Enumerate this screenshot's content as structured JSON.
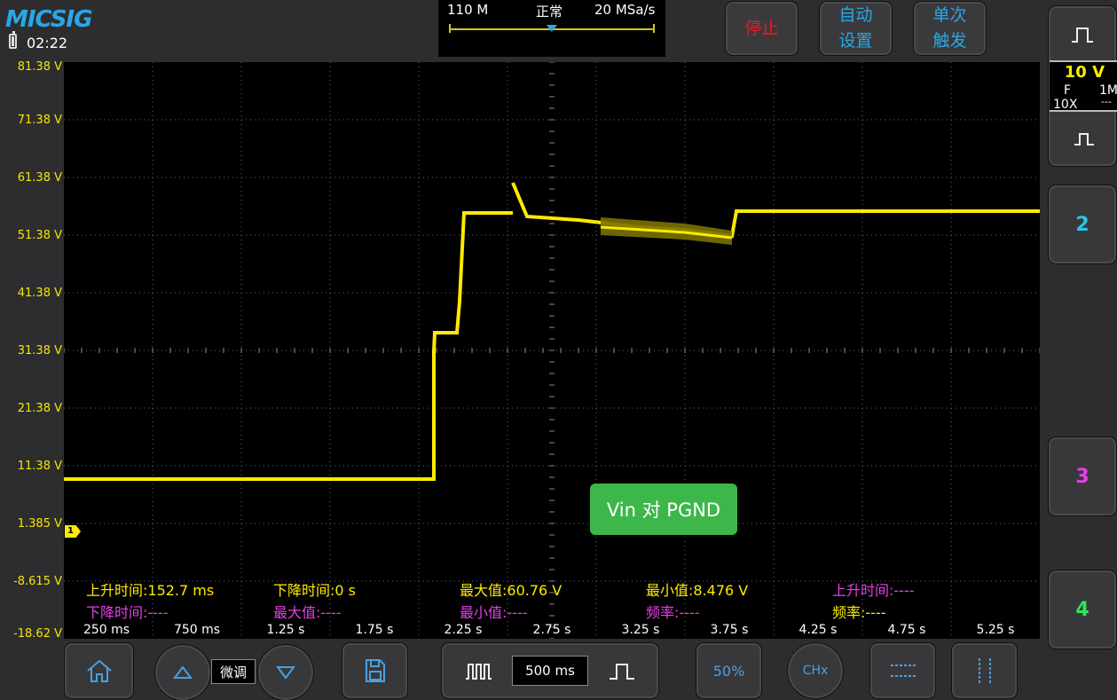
{
  "logo": "MICSIG",
  "status": {
    "time": "02:22"
  },
  "timebase": {
    "memory": "110 M",
    "mode": "正常",
    "sample_rate": "20 MSa/s"
  },
  "top_buttons": {
    "stop": {
      "label": "停止",
      "color": "#e02020"
    },
    "auto_setup": {
      "label_line1": "自动",
      "label_line2": "设置",
      "color": "#2aa7e6"
    },
    "single_trigger": {
      "label_line1": "单次",
      "label_line2": "触发",
      "color": "#2aa7e6"
    }
  },
  "channel1": {
    "scale": "10 V",
    "coupling": "F",
    "probe": "10X",
    "impedance": "1M",
    "impedance_sub": "---",
    "color": "#ffea00"
  },
  "channels": [
    {
      "label": "2",
      "color": "#29c5e6"
    },
    {
      "label": "3",
      "color": "#e83ee8"
    },
    {
      "label": "4",
      "color": "#2ee65a"
    }
  ],
  "y_axis_labels": [
    "81.38 V",
    "71.38 V",
    "61.38 V",
    "51.38 V",
    "41.38 V",
    "31.38 V",
    "21.38 V",
    "11.38 V",
    "1.385 V",
    "-8.615 V",
    "-18.62 V"
  ],
  "x_axis_labels": [
    "250 ms",
    "750 ms",
    "1.25 s",
    "1.75 s",
    "2.25 s",
    "2.75 s",
    "3.25 s",
    "3.75 s",
    "4.25 s",
    "4.75 s",
    "5.25 s"
  ],
  "trigger_marker": "1",
  "measurements": {
    "row1": [
      {
        "text": "上升时间:152.7 ms",
        "color": "#ffea00"
      },
      {
        "text": "下降时间:0 s",
        "color": "#ffea00"
      },
      {
        "text": "最大值:60.76 V",
        "color": "#ffea00"
      },
      {
        "text": "最小值:8.476 V",
        "color": "#ffea00"
      },
      {
        "text": "上升时间:----",
        "color": "#e83ee8"
      }
    ],
    "row2": [
      {
        "text": "下降时间:----",
        "color": "#e83ee8"
      },
      {
        "text": "最大值:----",
        "color": "#e83ee8"
      },
      {
        "text": "最小值:----",
        "color": "#e83ee8"
      },
      {
        "text": "频率:----",
        "color": "#e83ee8"
      },
      {
        "text": "频率:----",
        "color": "#ffea00"
      }
    ]
  },
  "annotation": "Vin 对 PGND",
  "bottom_toolbar": {
    "fine_label": "微调",
    "timebase_value": "500 ms",
    "half_label": "50%",
    "chx_label": "CHx"
  },
  "trace_color": "#ffea00"
}
